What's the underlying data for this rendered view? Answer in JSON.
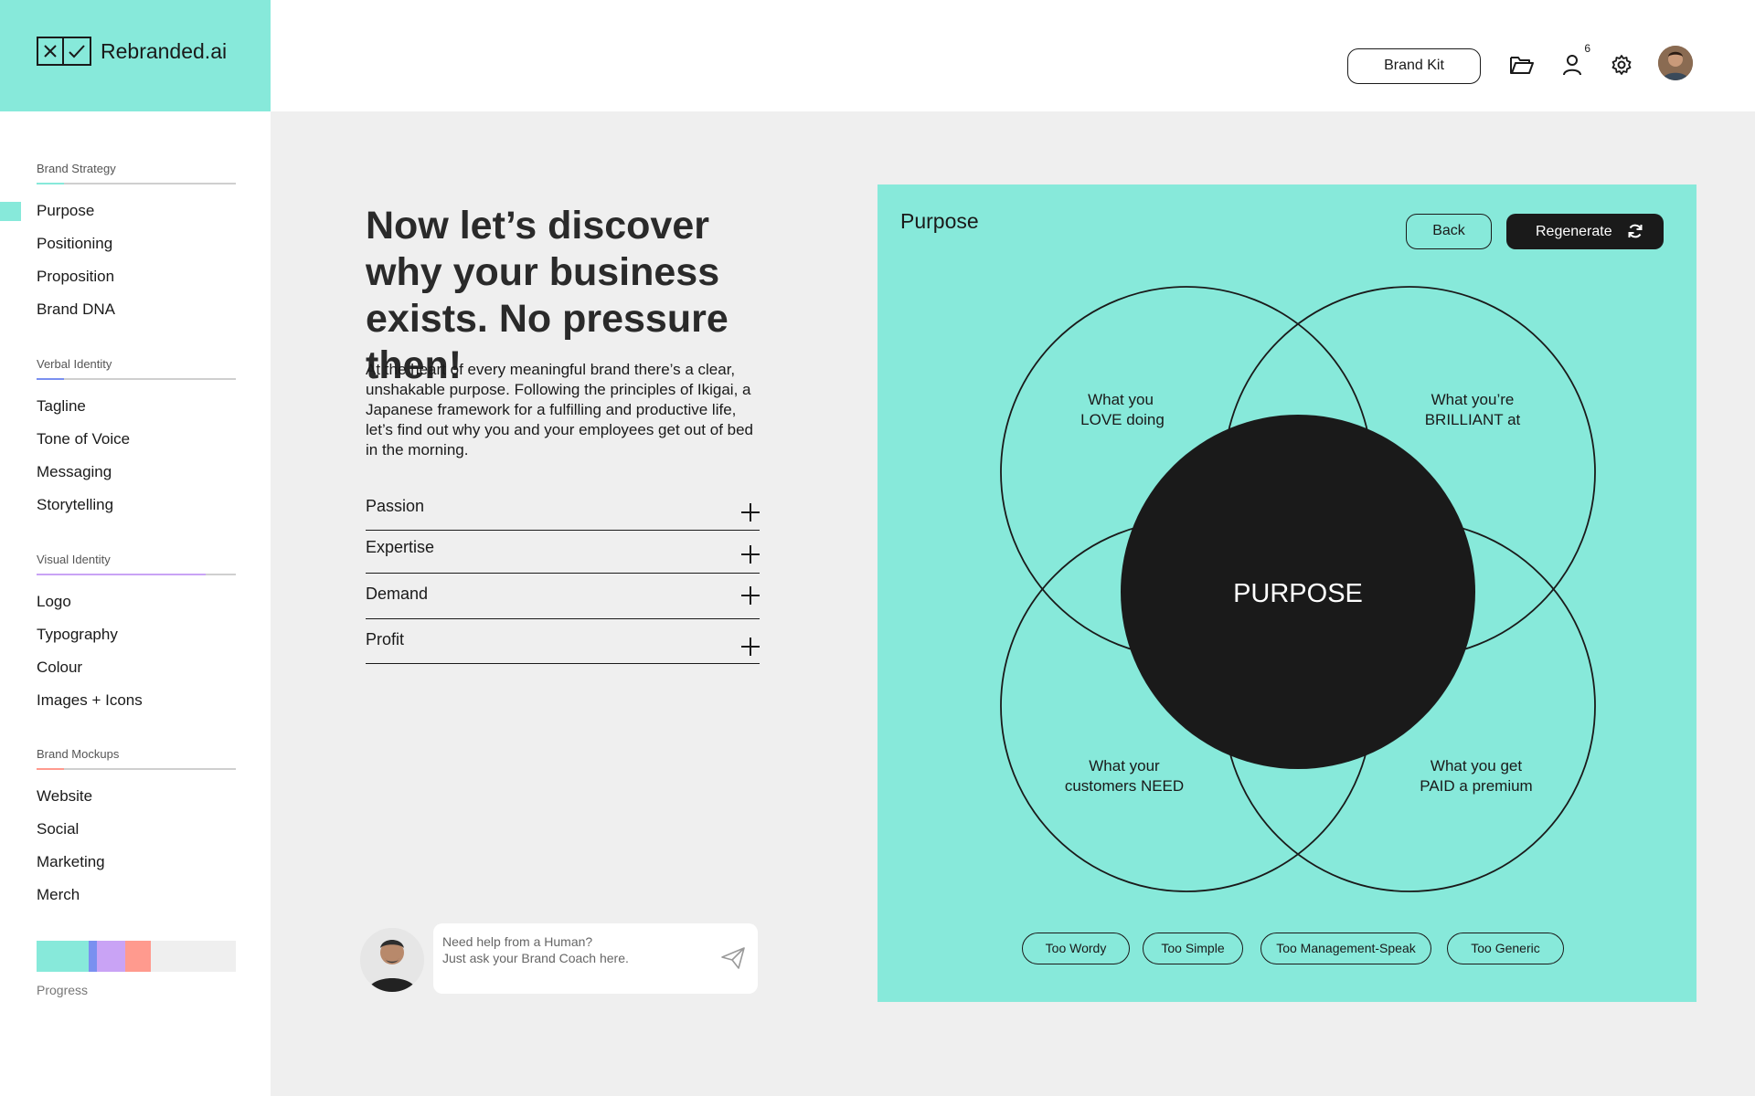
{
  "brand": {
    "name": "Rebranded.ai",
    "logo_icons": [
      "close-icon",
      "check-icon"
    ]
  },
  "colors": {
    "mint": "#87e9da",
    "dark": "#1a1a1a",
    "blue": "#7a90f0",
    "purple": "#c9a3f5",
    "salmon": "#ff9a8e",
    "progress_bg": "#efefef"
  },
  "sidebar": {
    "groups": [
      {
        "title": "Brand Strategy",
        "accent": "#87e9da",
        "items": [
          "Purpose",
          "Positioning",
          "Proposition",
          "Brand DNA"
        ]
      },
      {
        "title": "Verbal Identity",
        "accent": "#7a90f0",
        "items": [
          "Tagline",
          "Tone of Voice",
          "Messaging",
          "Storytelling"
        ]
      },
      {
        "title": "Visual Identity",
        "accent": "#c9a3f5",
        "items": [
          "Logo",
          "Typography",
          "Colour",
          "Images + Icons"
        ]
      },
      {
        "title": "Brand Mockups",
        "accent": "#ff9a8e",
        "items": [
          "Website",
          "Social",
          "Marketing",
          "Merch"
        ]
      }
    ],
    "active_item": "Purpose",
    "progress": {
      "label": "Progress",
      "segments": [
        {
          "color": "#87e9da",
          "fraction": 0.26
        },
        {
          "color": "#7a90f0",
          "fraction": 0.04
        },
        {
          "color": "#c9a3f5",
          "fraction": 0.14
        },
        {
          "color": "#ff9a8e",
          "fraction": 0.13
        }
      ]
    }
  },
  "header": {
    "brand_kit_label": "Brand Kit",
    "icons": [
      "folder-icon",
      "user-icon",
      "gear-icon"
    ],
    "user_badge": "6"
  },
  "main": {
    "headline": "Now let’s discover why your business exists. No pressure then!",
    "intro": "At the heart of every meaningful brand there’s a clear, unshakable purpose. Following the principles of Ikigai, a Japanese framework for a fulfilling and productive life, let’s find out why you and your employees get out of bed in the morning.",
    "accordion": [
      "Passion",
      "Expertise",
      "Demand",
      "Profit"
    ],
    "coach": {
      "line1": "Need help from a Human?",
      "line2": "Just ask your Brand Coach here."
    }
  },
  "purpose_card": {
    "title": "Purpose",
    "back_label": "Back",
    "regenerate_label": "Regenerate",
    "center_label": "PURPOSE",
    "quadrants": {
      "love": [
        "What you",
        "LOVE doing"
      ],
      "brilliant": [
        "What you’re",
        "BRILLIANT at"
      ],
      "need": [
        "What your",
        "customers NEED"
      ],
      "paid": [
        "What you get",
        "PAID a premium"
      ]
    },
    "feedback": [
      "Too Wordy",
      "Too Simple",
      "Too Management-Speak",
      "Too Generic"
    ]
  }
}
